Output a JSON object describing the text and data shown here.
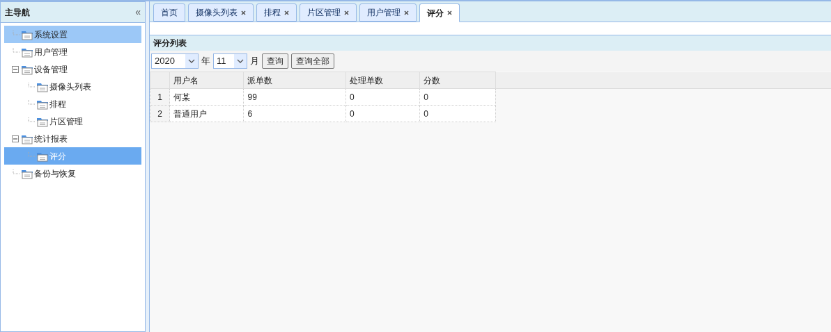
{
  "sidebar": {
    "title": "主导航",
    "collapse_icon": "«",
    "tree": [
      {
        "label": "系统设置",
        "selected": false,
        "hovered": true
      },
      {
        "label": "用户管理",
        "selected": false,
        "hovered": false
      },
      {
        "label": "设备管理",
        "selected": false,
        "hovered": false,
        "expanded": true,
        "children": [
          {
            "label": "摄像头列表",
            "selected": false,
            "hovered": false
          },
          {
            "label": "排程",
            "selected": false,
            "hovered": false
          },
          {
            "label": "片区管理",
            "selected": false,
            "hovered": false
          }
        ]
      },
      {
        "label": "统计报表",
        "selected": false,
        "hovered": false,
        "expanded": true,
        "children": [
          {
            "label": "评分",
            "selected": true,
            "hovered": false
          }
        ]
      },
      {
        "label": "备份与恢复",
        "selected": false,
        "hovered": false
      }
    ]
  },
  "tabs": [
    {
      "label": "首页",
      "selected": false,
      "closable": false
    },
    {
      "label": "摄像头列表",
      "selected": false,
      "closable": true
    },
    {
      "label": "排程",
      "selected": false,
      "closable": true
    },
    {
      "label": "片区管理",
      "selected": false,
      "closable": true
    },
    {
      "label": "用户管理",
      "selected": false,
      "closable": true
    },
    {
      "label": "评分",
      "selected": true,
      "closable": true
    }
  ],
  "panel": {
    "title": "评分列表",
    "filters": {
      "year": "2020",
      "year_label": "年",
      "month": "11",
      "month_label": "月",
      "buttons": [
        "查询",
        "查询全部"
      ]
    },
    "table": {
      "columns": [
        "用户名",
        "派单数",
        "处理单数",
        "分数"
      ],
      "rows": [
        {
          "number": "1",
          "cells": [
            "何某",
            "99",
            "0",
            "0"
          ]
        },
        {
          "number": "2",
          "cells": [
            "普通用户",
            "6",
            "0",
            "0"
          ]
        }
      ]
    }
  }
}
